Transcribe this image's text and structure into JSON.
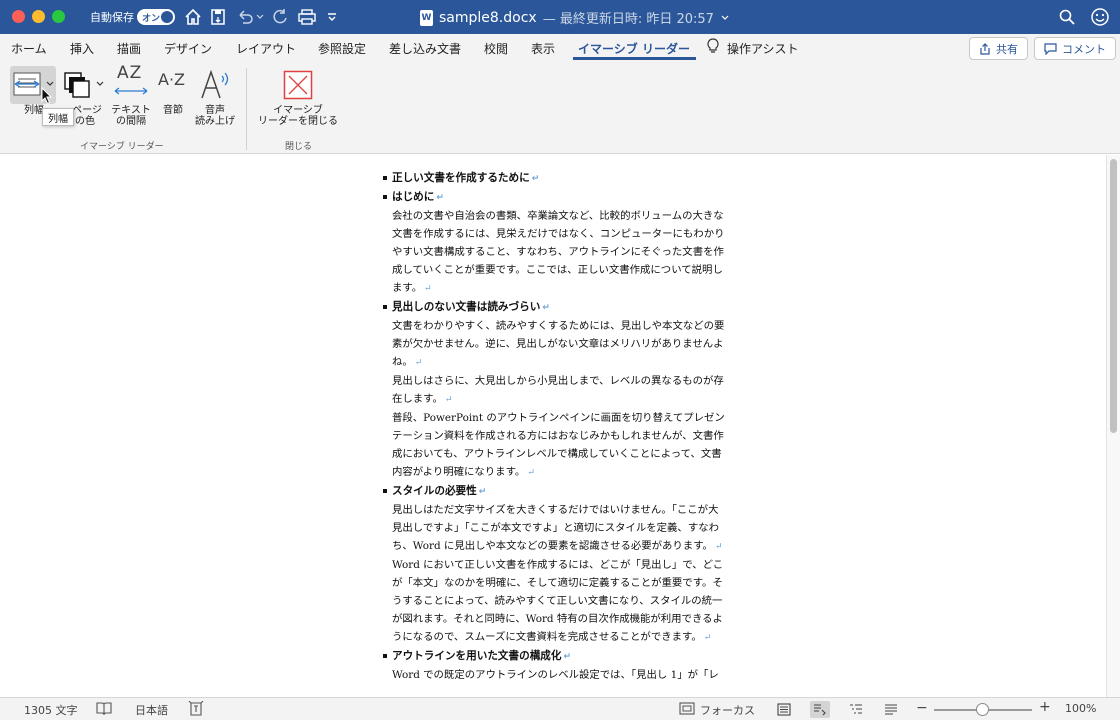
{
  "titlebar": {
    "autosave_label": "自動保存",
    "autosave_state": "オン",
    "doc_name": "sample8.docx",
    "doc_meta": "— 最終更新日時: 昨日 20:57",
    "word_icon_letter": "W",
    "icons": [
      "home-icon",
      "save-icon",
      "undo-icon",
      "redo-icon",
      "print-icon",
      "customize-icon",
      "search-icon",
      "feedback-icon"
    ]
  },
  "tabs": [
    {
      "label": "ホーム"
    },
    {
      "label": "挿入"
    },
    {
      "label": "描画"
    },
    {
      "label": "デザイン"
    },
    {
      "label": "レイアウト"
    },
    {
      "label": "参照設定"
    },
    {
      "label": "差し込み文書"
    },
    {
      "label": "校閲"
    },
    {
      "label": "表示"
    },
    {
      "label": "イマーシブ リーダー"
    },
    {
      "label": "操作アシスト"
    }
  ],
  "share_label": "共有",
  "comment_label": "コメント",
  "ribbon": {
    "column_width": "列幅",
    "page_color_l1": "ページ",
    "page_color_l2": "の色",
    "text_spacing_l1": "テキスト",
    "text_spacing_l2": "の間隔",
    "syllables": "音節",
    "read_aloud_l1": "音声",
    "read_aloud_l2": "読み上げ",
    "close_l1": "イマーシブ",
    "close_l2": "リーダーを閉じる",
    "group_immersive": "イマーシブ リーダー",
    "group_close": "閉じる",
    "tooltip": "列幅",
    "az_text": "AZ",
    "a_z_text": "A·Z"
  },
  "document": {
    "h1": "正しい文書を作成するために",
    "h2": "はじめに",
    "p1": "会社の文書や自治会の書類、卒業論文など、比較的ボリュームの大きな文書を作成するには、見栄えだけではなく、コンピューターにもわかりやすい文書構成すること、すなわち、アウトラインにそぐった文書を作成していくことが重要です。ここでは、正しい文書作成について説明します。",
    "h3": "見出しのない文書は読みづらい",
    "p2": "文書をわかりやすく、読みやすくするためには、見出しや本文などの要素が欠かせません。逆に、見出しがない文章はメリハリがありませんよね。",
    "p3": "見出しはさらに、大見出しから小見出しまで、レベルの異なるものが存在します。",
    "p4": "普段、PowerPoint のアウトラインペインに画面を切り替えてプレゼンテーション資料を作成される方にはおなじみかもしれませんが、文書作成においても、アウトラインレベルで構成していくことによって、文書内容がより明確になります。",
    "h4": "スタイルの必要性",
    "p5": "見出しはただ文字サイズを大きくするだけではいけません。「ここが大見出しですよ」「ここが本文ですよ」と適切にスタイルを定義、すなわち、Word に見出しや本文などの要素を認識させる必要があります。",
    "p6": "Word において正しい文書を作成するには、どこが「見出し」で、どこが「本文」なのかを明確に、そして適切に定義することが重要です。そうすることによって、読みやすくて正しい文書になり、スタイルの統一が図れます。それと同時に、Word 特有の目次作成機能が利用できるようになるので、スムーズに文書資料を完成させることができます。",
    "h5": "アウトラインを用いた文書の構成化",
    "p7": "Word での既定のアウトラインのレベル設定では、「見出し 1」が「レ",
    "pilcrow": "↵"
  },
  "status": {
    "word_count": "1305 文字",
    "language": "日本語",
    "focus": "フォーカス",
    "zoom": "100%",
    "zoom_minus": "−",
    "zoom_plus": "+"
  },
  "colors": {
    "accent": "#2b579a",
    "close_red": "#e04040"
  }
}
